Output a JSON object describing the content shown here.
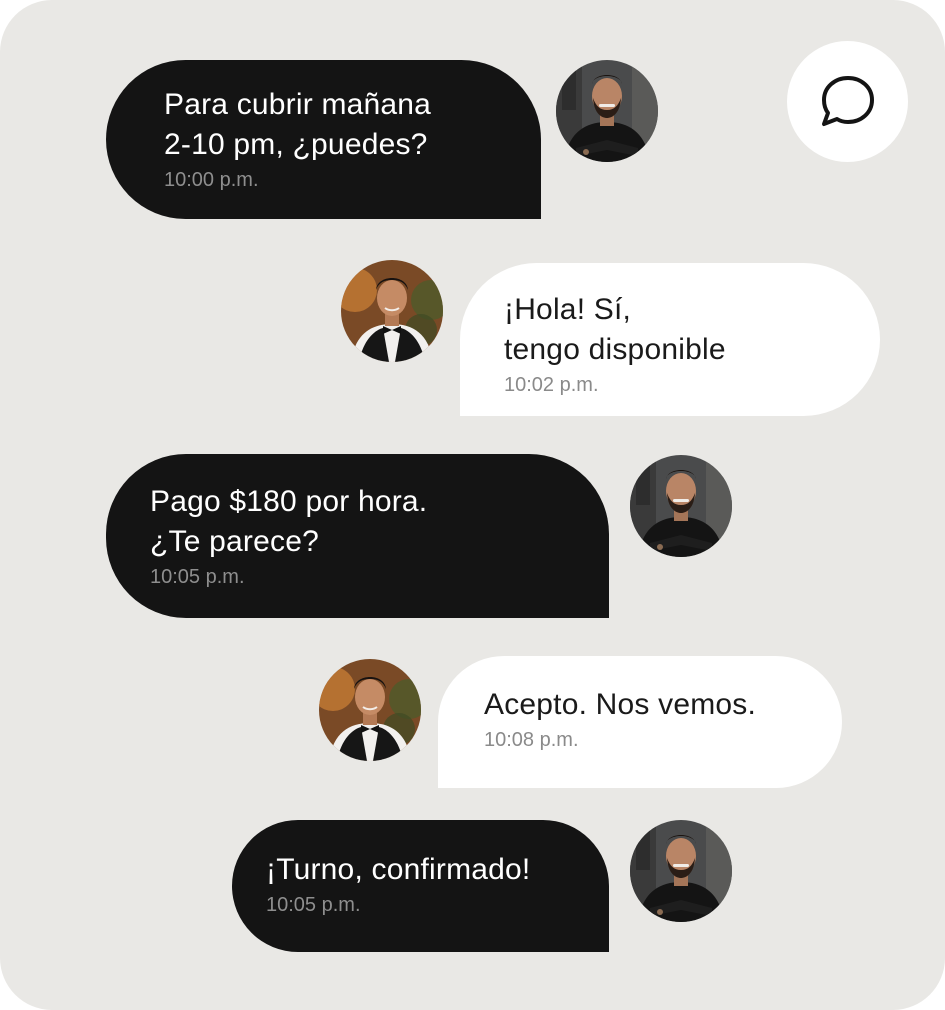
{
  "chat_icon": "speech-bubble-icon",
  "messages": [
    {
      "side": "manager",
      "text": "Para cubrir mañana\n2-10 pm, ¿puedes?",
      "time": "10:00 p.m."
    },
    {
      "side": "waiter",
      "text": "¡Hola! Sí,\ntengo disponible",
      "time": "10:02 p.m."
    },
    {
      "side": "manager",
      "text": "Pago $180 por hora.\n¿Te parece?",
      "time": "10:05 p.m."
    },
    {
      "side": "waiter",
      "text": "Acepto. Nos vemos.",
      "time": "10:08 p.m."
    },
    {
      "side": "manager",
      "text": "¡Turno, confirmado!",
      "time": "10:05 p.m."
    }
  ],
  "colors": {
    "background": "#e9e8e5",
    "outgoing_bubble": "#141414",
    "incoming_bubble": "#ffffff",
    "timestamp": "#8a8a8a"
  }
}
